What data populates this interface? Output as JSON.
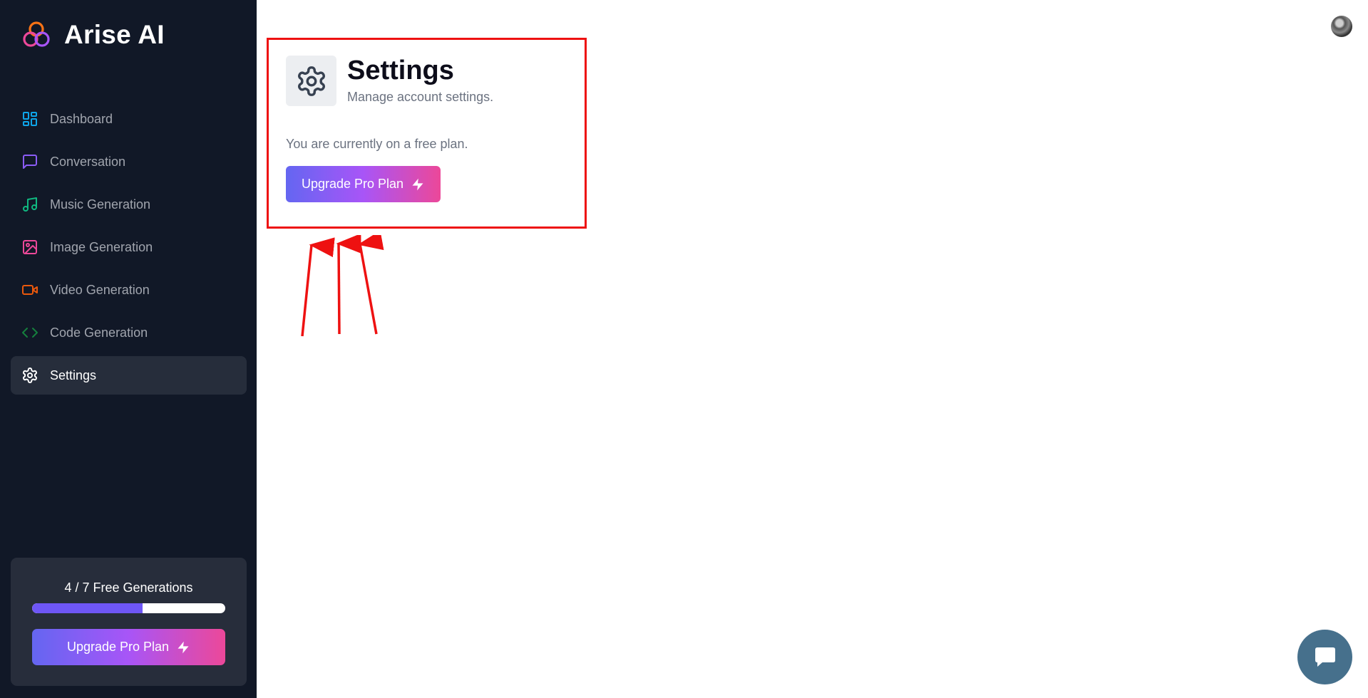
{
  "app": {
    "name": "Arise AI"
  },
  "sidebar": {
    "items": [
      {
        "label": "Dashboard",
        "icon": "dashboard-icon",
        "color": "#0ea5e9",
        "active": false
      },
      {
        "label": "Conversation",
        "icon": "message-square-icon",
        "color": "#8b5cf6",
        "active": false
      },
      {
        "label": "Music Generation",
        "icon": "music-icon",
        "color": "#10b981",
        "active": false
      },
      {
        "label": "Image Generation",
        "icon": "image-icon",
        "color": "#ec4899",
        "active": false
      },
      {
        "label": "Video Generation",
        "icon": "video-icon",
        "color": "#ea580c",
        "active": false
      },
      {
        "label": "Code Generation",
        "icon": "code-icon",
        "color": "#15803d",
        "active": false
      },
      {
        "label": "Settings",
        "icon": "gear-icon",
        "color": "#ffffff",
        "active": true
      }
    ],
    "free_card": {
      "used": 4,
      "limit": 7,
      "text": "4 / 7 Free Generations",
      "upgrade_label": "Upgrade Pro Plan"
    }
  },
  "main": {
    "title": "Settings",
    "subtitle": "Manage account settings.",
    "plan_text": "You are currently on a free plan.",
    "upgrade_label": "Upgrade Pro Plan"
  },
  "colors": {
    "sidebar_bg": "#111827",
    "accent_gradient": [
      "#6466f1",
      "#a855f7",
      "#ec4899"
    ],
    "annotation": "#ee1111",
    "chat_bubble": "#46708c"
  }
}
